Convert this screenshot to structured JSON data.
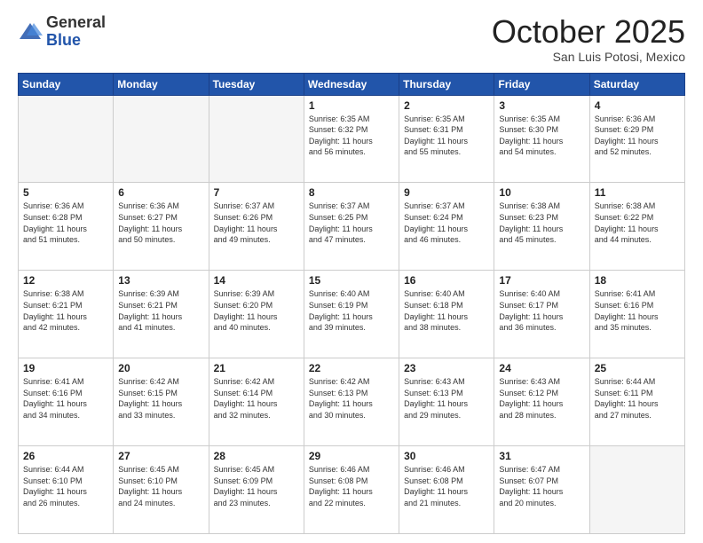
{
  "header": {
    "logo_general": "General",
    "logo_blue": "Blue",
    "month_title": "October 2025",
    "location": "San Luis Potosi, Mexico"
  },
  "weekdays": [
    "Sunday",
    "Monday",
    "Tuesday",
    "Wednesday",
    "Thursday",
    "Friday",
    "Saturday"
  ],
  "weeks": [
    [
      {
        "day": "",
        "info": ""
      },
      {
        "day": "",
        "info": ""
      },
      {
        "day": "",
        "info": ""
      },
      {
        "day": "1",
        "info": "Sunrise: 6:35 AM\nSunset: 6:32 PM\nDaylight: 11 hours\nand 56 minutes."
      },
      {
        "day": "2",
        "info": "Sunrise: 6:35 AM\nSunset: 6:31 PM\nDaylight: 11 hours\nand 55 minutes."
      },
      {
        "day": "3",
        "info": "Sunrise: 6:35 AM\nSunset: 6:30 PM\nDaylight: 11 hours\nand 54 minutes."
      },
      {
        "day": "4",
        "info": "Sunrise: 6:36 AM\nSunset: 6:29 PM\nDaylight: 11 hours\nand 52 minutes."
      }
    ],
    [
      {
        "day": "5",
        "info": "Sunrise: 6:36 AM\nSunset: 6:28 PM\nDaylight: 11 hours\nand 51 minutes."
      },
      {
        "day": "6",
        "info": "Sunrise: 6:36 AM\nSunset: 6:27 PM\nDaylight: 11 hours\nand 50 minutes."
      },
      {
        "day": "7",
        "info": "Sunrise: 6:37 AM\nSunset: 6:26 PM\nDaylight: 11 hours\nand 49 minutes."
      },
      {
        "day": "8",
        "info": "Sunrise: 6:37 AM\nSunset: 6:25 PM\nDaylight: 11 hours\nand 47 minutes."
      },
      {
        "day": "9",
        "info": "Sunrise: 6:37 AM\nSunset: 6:24 PM\nDaylight: 11 hours\nand 46 minutes."
      },
      {
        "day": "10",
        "info": "Sunrise: 6:38 AM\nSunset: 6:23 PM\nDaylight: 11 hours\nand 45 minutes."
      },
      {
        "day": "11",
        "info": "Sunrise: 6:38 AM\nSunset: 6:22 PM\nDaylight: 11 hours\nand 44 minutes."
      }
    ],
    [
      {
        "day": "12",
        "info": "Sunrise: 6:38 AM\nSunset: 6:21 PM\nDaylight: 11 hours\nand 42 minutes."
      },
      {
        "day": "13",
        "info": "Sunrise: 6:39 AM\nSunset: 6:21 PM\nDaylight: 11 hours\nand 41 minutes."
      },
      {
        "day": "14",
        "info": "Sunrise: 6:39 AM\nSunset: 6:20 PM\nDaylight: 11 hours\nand 40 minutes."
      },
      {
        "day": "15",
        "info": "Sunrise: 6:40 AM\nSunset: 6:19 PM\nDaylight: 11 hours\nand 39 minutes."
      },
      {
        "day": "16",
        "info": "Sunrise: 6:40 AM\nSunset: 6:18 PM\nDaylight: 11 hours\nand 38 minutes."
      },
      {
        "day": "17",
        "info": "Sunrise: 6:40 AM\nSunset: 6:17 PM\nDaylight: 11 hours\nand 36 minutes."
      },
      {
        "day": "18",
        "info": "Sunrise: 6:41 AM\nSunset: 6:16 PM\nDaylight: 11 hours\nand 35 minutes."
      }
    ],
    [
      {
        "day": "19",
        "info": "Sunrise: 6:41 AM\nSunset: 6:16 PM\nDaylight: 11 hours\nand 34 minutes."
      },
      {
        "day": "20",
        "info": "Sunrise: 6:42 AM\nSunset: 6:15 PM\nDaylight: 11 hours\nand 33 minutes."
      },
      {
        "day": "21",
        "info": "Sunrise: 6:42 AM\nSunset: 6:14 PM\nDaylight: 11 hours\nand 32 minutes."
      },
      {
        "day": "22",
        "info": "Sunrise: 6:42 AM\nSunset: 6:13 PM\nDaylight: 11 hours\nand 30 minutes."
      },
      {
        "day": "23",
        "info": "Sunrise: 6:43 AM\nSunset: 6:13 PM\nDaylight: 11 hours\nand 29 minutes."
      },
      {
        "day": "24",
        "info": "Sunrise: 6:43 AM\nSunset: 6:12 PM\nDaylight: 11 hours\nand 28 minutes."
      },
      {
        "day": "25",
        "info": "Sunrise: 6:44 AM\nSunset: 6:11 PM\nDaylight: 11 hours\nand 27 minutes."
      }
    ],
    [
      {
        "day": "26",
        "info": "Sunrise: 6:44 AM\nSunset: 6:10 PM\nDaylight: 11 hours\nand 26 minutes."
      },
      {
        "day": "27",
        "info": "Sunrise: 6:45 AM\nSunset: 6:10 PM\nDaylight: 11 hours\nand 24 minutes."
      },
      {
        "day": "28",
        "info": "Sunrise: 6:45 AM\nSunset: 6:09 PM\nDaylight: 11 hours\nand 23 minutes."
      },
      {
        "day": "29",
        "info": "Sunrise: 6:46 AM\nSunset: 6:08 PM\nDaylight: 11 hours\nand 22 minutes."
      },
      {
        "day": "30",
        "info": "Sunrise: 6:46 AM\nSunset: 6:08 PM\nDaylight: 11 hours\nand 21 minutes."
      },
      {
        "day": "31",
        "info": "Sunrise: 6:47 AM\nSunset: 6:07 PM\nDaylight: 11 hours\nand 20 minutes."
      },
      {
        "day": "",
        "info": ""
      }
    ]
  ]
}
